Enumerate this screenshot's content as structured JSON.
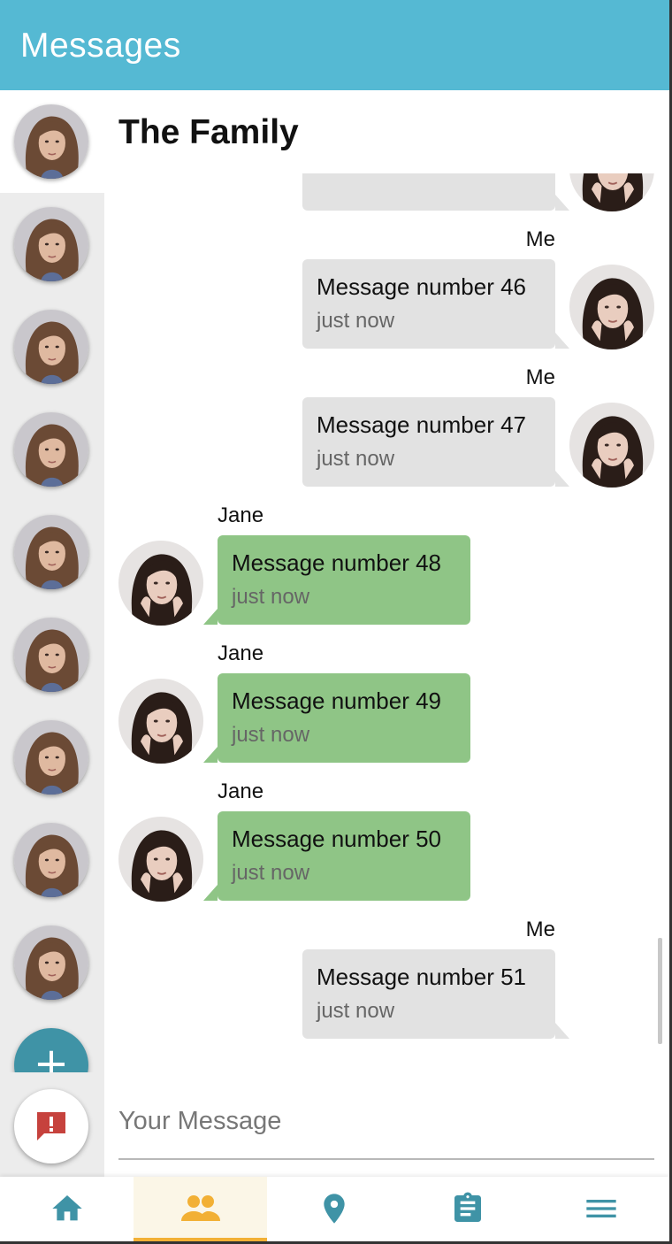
{
  "app": {
    "title": "Messages"
  },
  "conversation": {
    "title": "The Family"
  },
  "colors": {
    "appbar": "#55b9d3",
    "my_bubble": "#e2e2e2",
    "their_bubble": "#8fc586",
    "nav_icon": "#3f93a6",
    "nav_active_icon": "#f2b035",
    "alert_icon": "#c6423d"
  },
  "sidebar": {
    "contact_count": 9,
    "add_button_icon": "plus-icon",
    "alert_button_icon": "alert-icon"
  },
  "messages": [
    {
      "sender": "",
      "text": "",
      "time": "",
      "mine": true
    },
    {
      "sender": "Me",
      "text": "Message number 46",
      "time": "just now",
      "mine": true
    },
    {
      "sender": "Me",
      "text": "Message number 47",
      "time": "just now",
      "mine": true
    },
    {
      "sender": "Jane",
      "text": "Message number 48",
      "time": "just now",
      "mine": false
    },
    {
      "sender": "Jane",
      "text": "Message number 49",
      "time": "just now",
      "mine": false
    },
    {
      "sender": "Jane",
      "text": "Message number 50",
      "time": "just now",
      "mine": false
    },
    {
      "sender": "Me",
      "text": "Message number 51",
      "time": "just now",
      "mine": true
    }
  ],
  "composer": {
    "placeholder": "Your Message",
    "value": ""
  },
  "bottom_nav": [
    {
      "icon": "home-icon",
      "active": false
    },
    {
      "icon": "group-icon",
      "active": true
    },
    {
      "icon": "location-pin-icon",
      "active": false
    },
    {
      "icon": "clipboard-icon",
      "active": false
    },
    {
      "icon": "menu-icon",
      "active": false
    }
  ]
}
